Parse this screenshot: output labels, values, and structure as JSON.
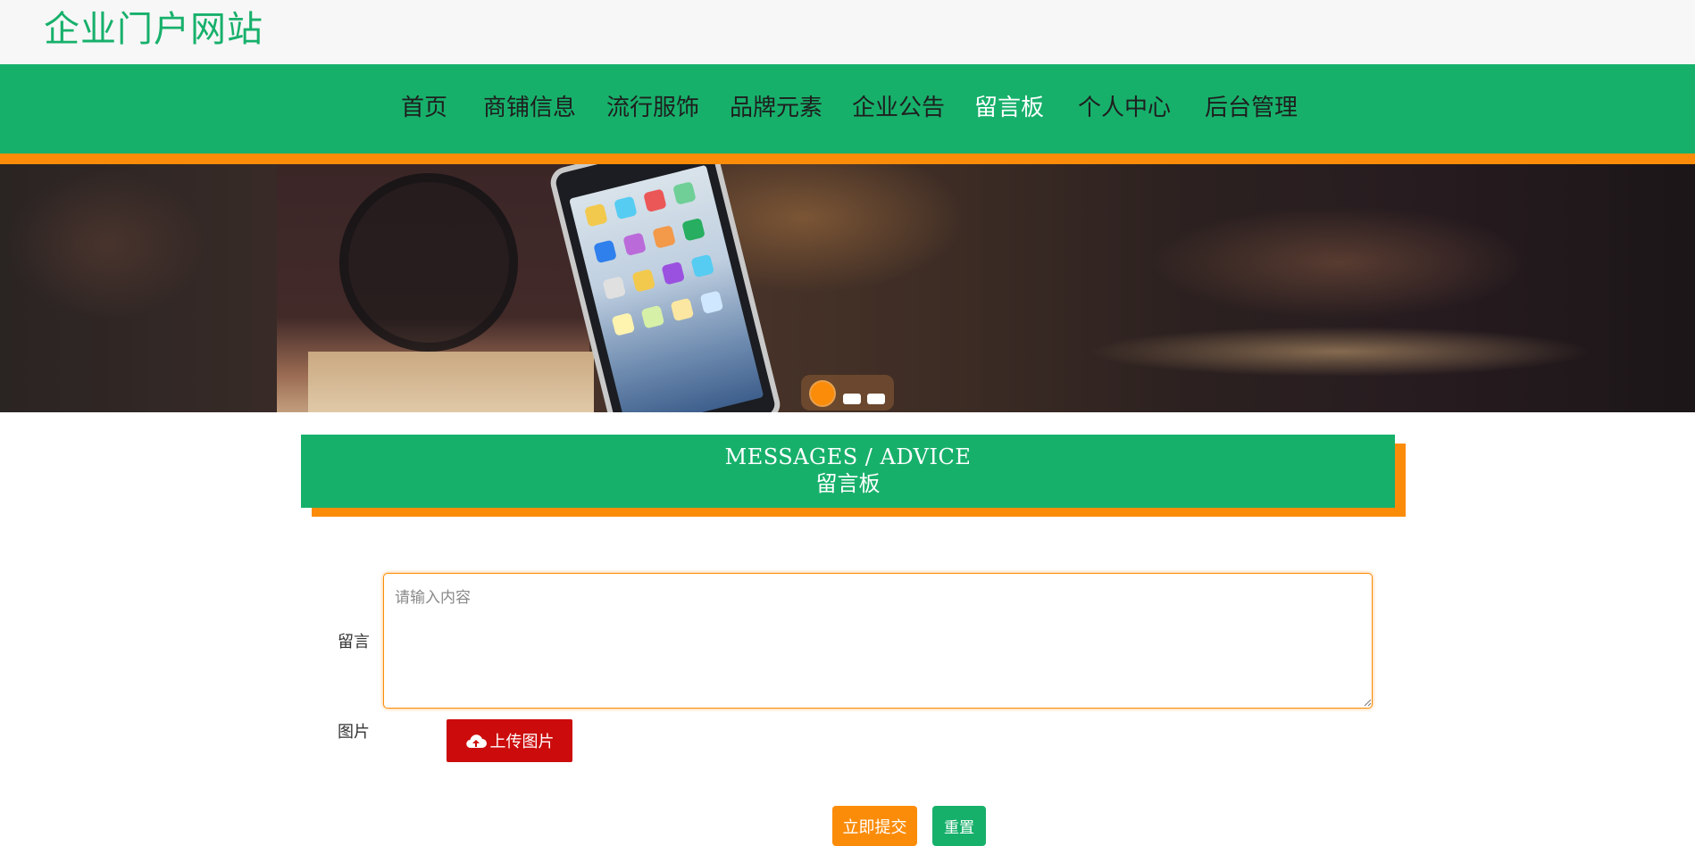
{
  "header": {
    "site_title": "企业门户网站"
  },
  "nav": {
    "items": [
      {
        "label": "首页",
        "active": false
      },
      {
        "label": "商铺信息",
        "active": false
      },
      {
        "label": "流行服饰",
        "active": false
      },
      {
        "label": "品牌元素",
        "active": false
      },
      {
        "label": "企业公告",
        "active": false
      },
      {
        "label": "留言板",
        "active": true
      },
      {
        "label": "个人中心",
        "active": false
      },
      {
        "label": "后台管理",
        "active": false
      }
    ]
  },
  "banner": {
    "slide_count": 3,
    "active_slide": 1
  },
  "section": {
    "heading_en": "MESSAGES / ADVICE",
    "heading_cn": "留言板"
  },
  "form": {
    "message_label": "留言",
    "message_placeholder": "请输入内容",
    "message_value": "",
    "image_label": "图片",
    "upload_label": "上传图片",
    "upload_icon": "cloud-upload-icon",
    "submit_label": "立即提交",
    "reset_label": "重置"
  },
  "colors": {
    "primary_green": "#17b06b",
    "accent_orange": "#fb8c0a",
    "upload_red": "#cc0c0c"
  }
}
